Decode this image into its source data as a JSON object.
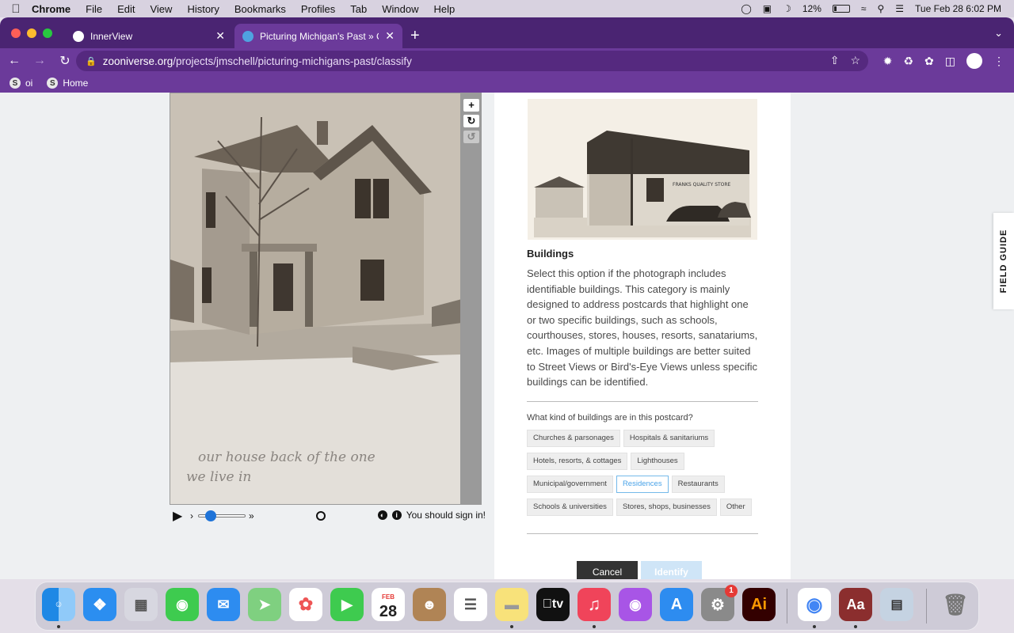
{
  "menubar": {
    "items": [
      "Chrome",
      "File",
      "Edit",
      "View",
      "History",
      "Bookmarks",
      "Profiles",
      "Tab",
      "Window",
      "Help"
    ],
    "battery": "12%",
    "datetime": "Tue Feb 28  6:02 PM"
  },
  "browser": {
    "tabs": [
      {
        "title": "InnerView"
      },
      {
        "title": "Picturing Michigan's Past » Cla"
      }
    ],
    "url_host": "zooniverse.org",
    "url_path": "/projects/jmschell/picturing-michigans-past/classify",
    "bookmarks": [
      {
        "label": "oi"
      },
      {
        "label": "Home"
      }
    ]
  },
  "viewer": {
    "handwriting": "our house back of the one we live in",
    "signin_message": "You should sign in!"
  },
  "task": {
    "heading": "Buildings",
    "description": "Select this option if the photograph includes identifiable buildings. This category is mainly designed to address postcards that highlight one or two specific buildings, such as schools, courthouses, stores, houses, resorts, sanatariums, etc. Images of multiple buildings are better suited to Street Views or Bird's-Eye Views unless specific buildings can be identified.",
    "reference_sign": "FRANKS QUALITY STORE",
    "question": "What kind of buildings are in this postcard?",
    "choices": [
      "Churches & parsonages",
      "Hospitals & sanitariums",
      "Hotels, resorts, & cottages",
      "Lighthouses",
      "Municipal/government",
      "Residences",
      "Restaurants",
      "Schools & universities",
      "Stores, shops, businesses",
      "Other"
    ],
    "selected": "Residences",
    "cancel_label": "Cancel",
    "identify_label": "Identify"
  },
  "field_guide": "FIELD GUIDE",
  "dock": {
    "calendar_month": "FEB",
    "calendar_day": "28",
    "settings_badge": "1",
    "tv_label": "tv",
    "illustrator_label": "Ai",
    "dictionary_label": "Aa"
  }
}
